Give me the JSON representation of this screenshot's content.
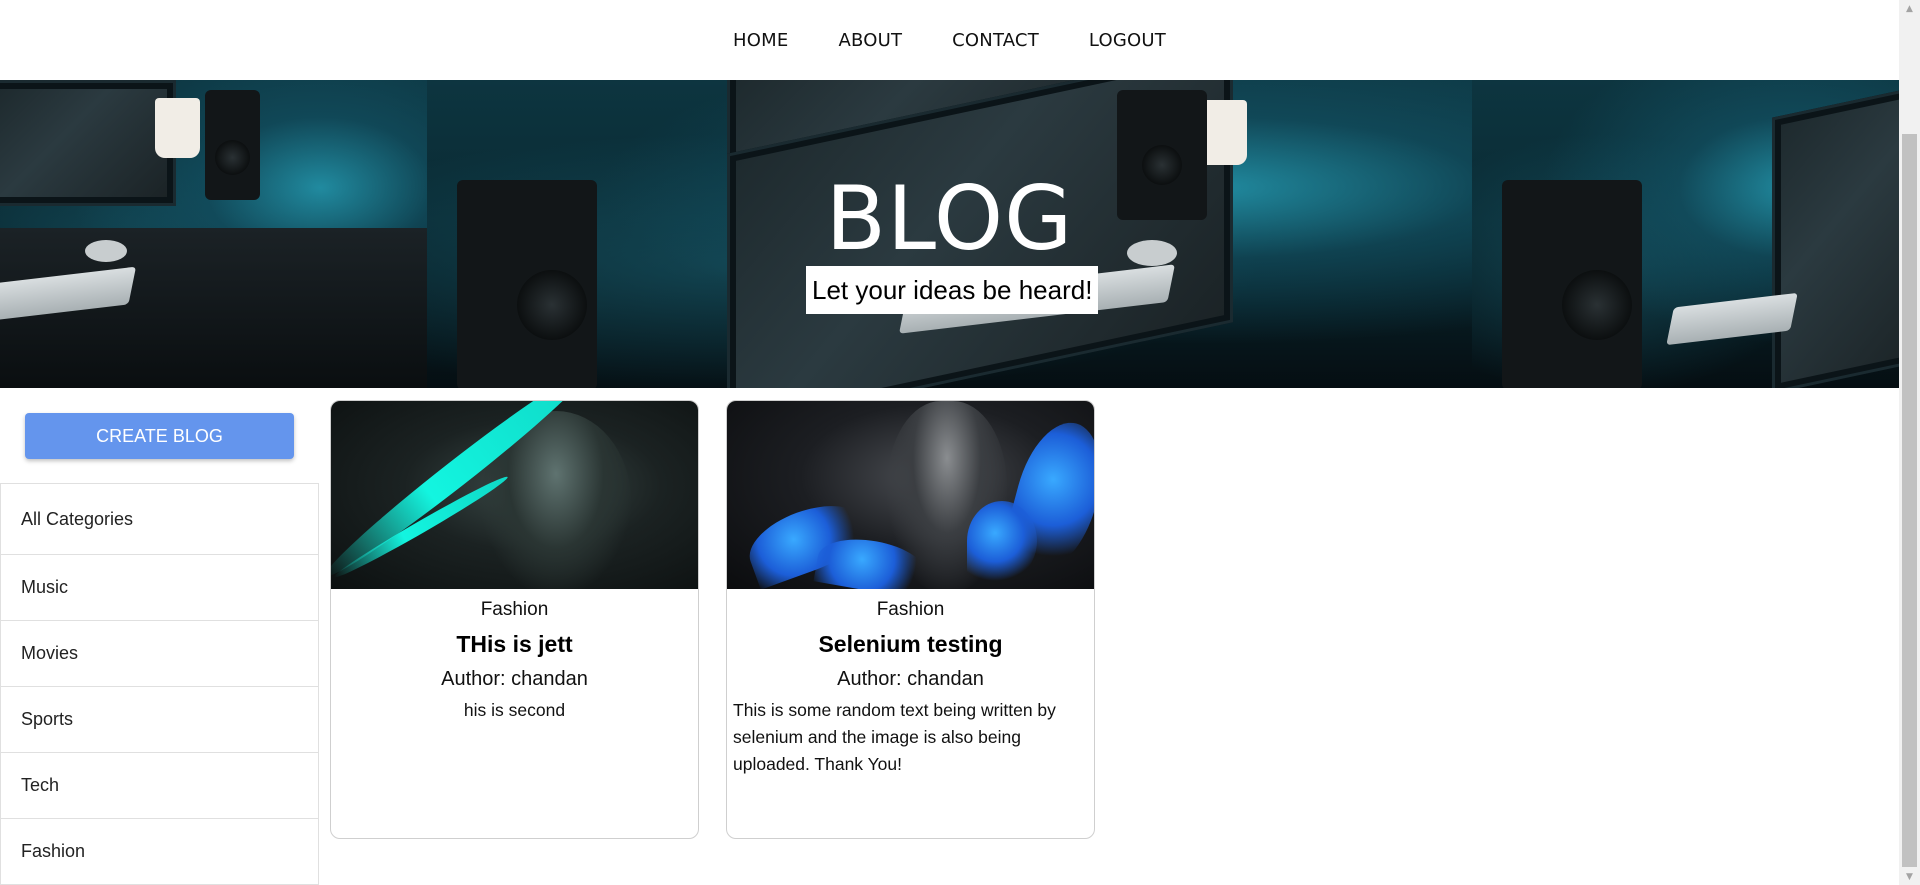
{
  "nav": {
    "items": [
      {
        "label": "HOME"
      },
      {
        "label": "ABOUT"
      },
      {
        "label": "CONTACT"
      },
      {
        "label": "LOGOUT"
      }
    ]
  },
  "banner": {
    "title": "BLOG",
    "subtitle": "Let your ideas be heard!"
  },
  "sidebar": {
    "create_button": "CREATE BLOG",
    "categories": [
      {
        "label": "All Categories"
      },
      {
        "label": "Music"
      },
      {
        "label": "Movies"
      },
      {
        "label": "Sports"
      },
      {
        "label": "Tech"
      },
      {
        "label": "Fashion"
      }
    ]
  },
  "posts": [
    {
      "category": "Fashion",
      "title": "THis is jett",
      "author": "Author: chandan",
      "description": "his is second"
    },
    {
      "category": "Fashion",
      "title": "Selenium testing",
      "author": "Author: chandan",
      "description": "This is some random text being written by selenium and the image is also being uploaded. Thank You!"
    }
  ],
  "scrollbar": {
    "up_icon": "▲",
    "down_icon": "▼"
  }
}
